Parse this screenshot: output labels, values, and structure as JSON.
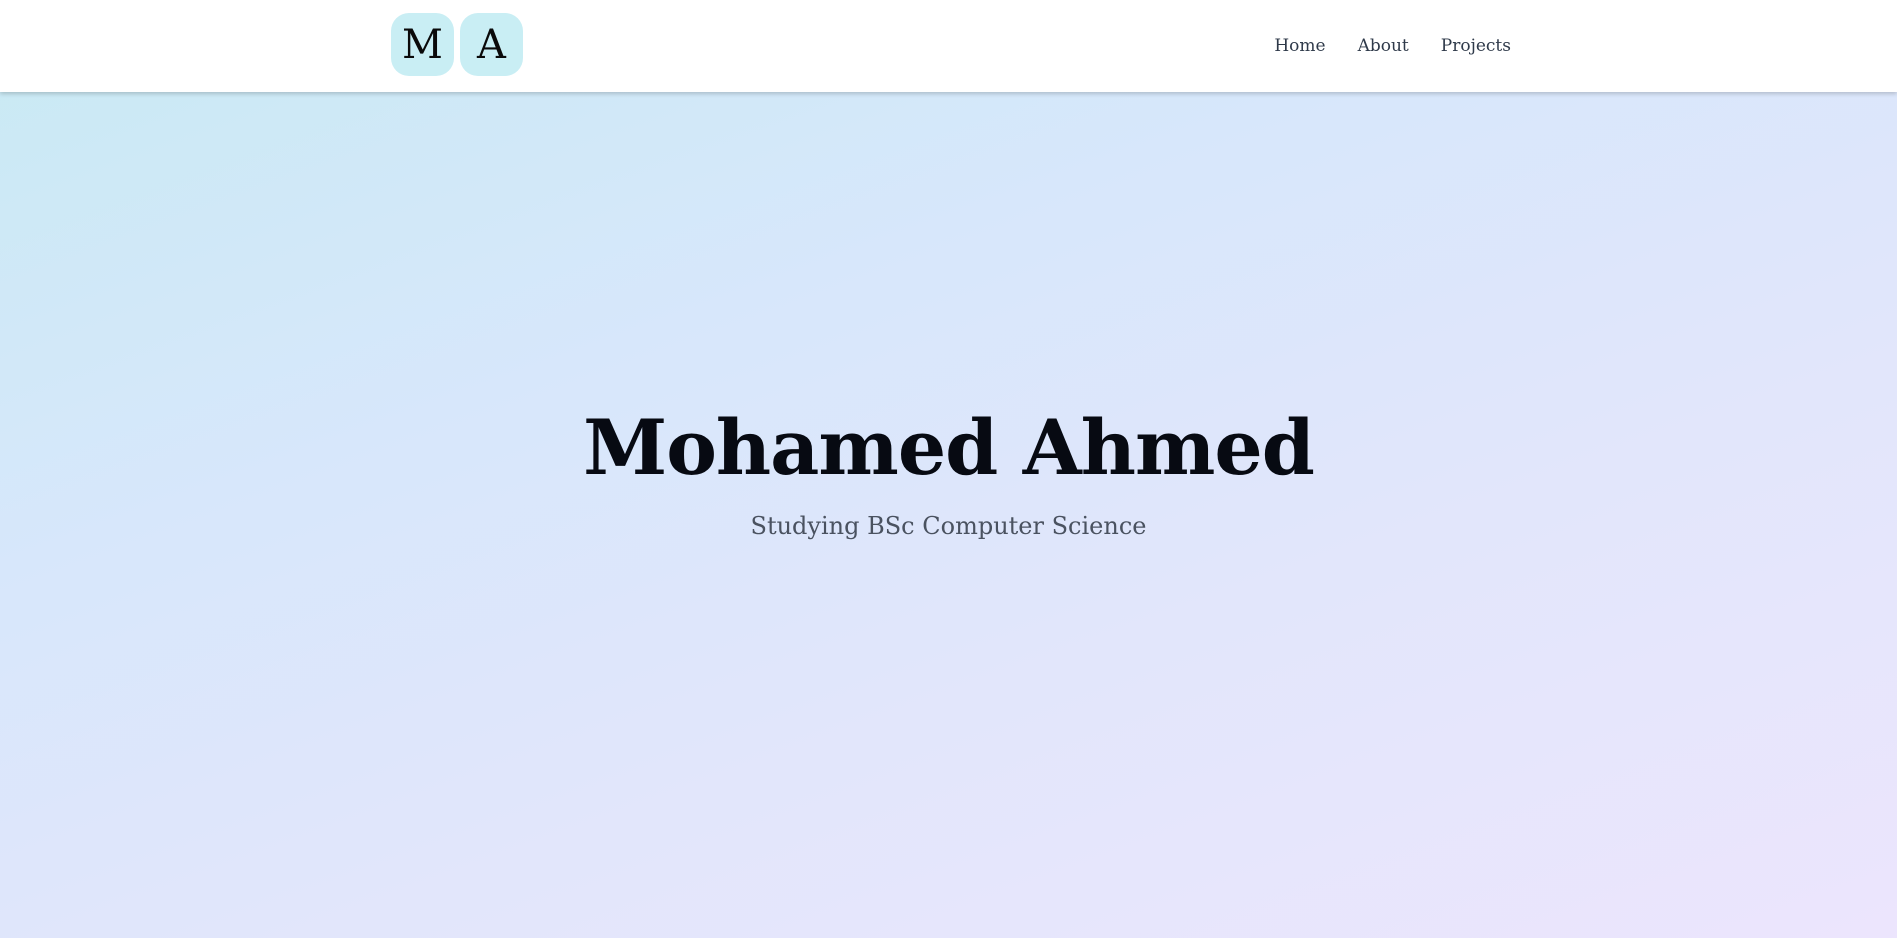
{
  "header": {
    "logo_letters": [
      "M",
      "A"
    ],
    "nav": [
      {
        "label": "Home"
      },
      {
        "label": "About"
      },
      {
        "label": "Projects"
      }
    ]
  },
  "hero": {
    "title": "Mohamed Ahmed",
    "subtitle": "Studying BSc Computer Science"
  },
  "colors": {
    "logo_tile_bg": "#c9eef4",
    "background_gradient": [
      "#c8eaf3",
      "#d7e7fb",
      "#e2e6fb",
      "#ece5fd"
    ],
    "header_bg": "#ffffff"
  }
}
